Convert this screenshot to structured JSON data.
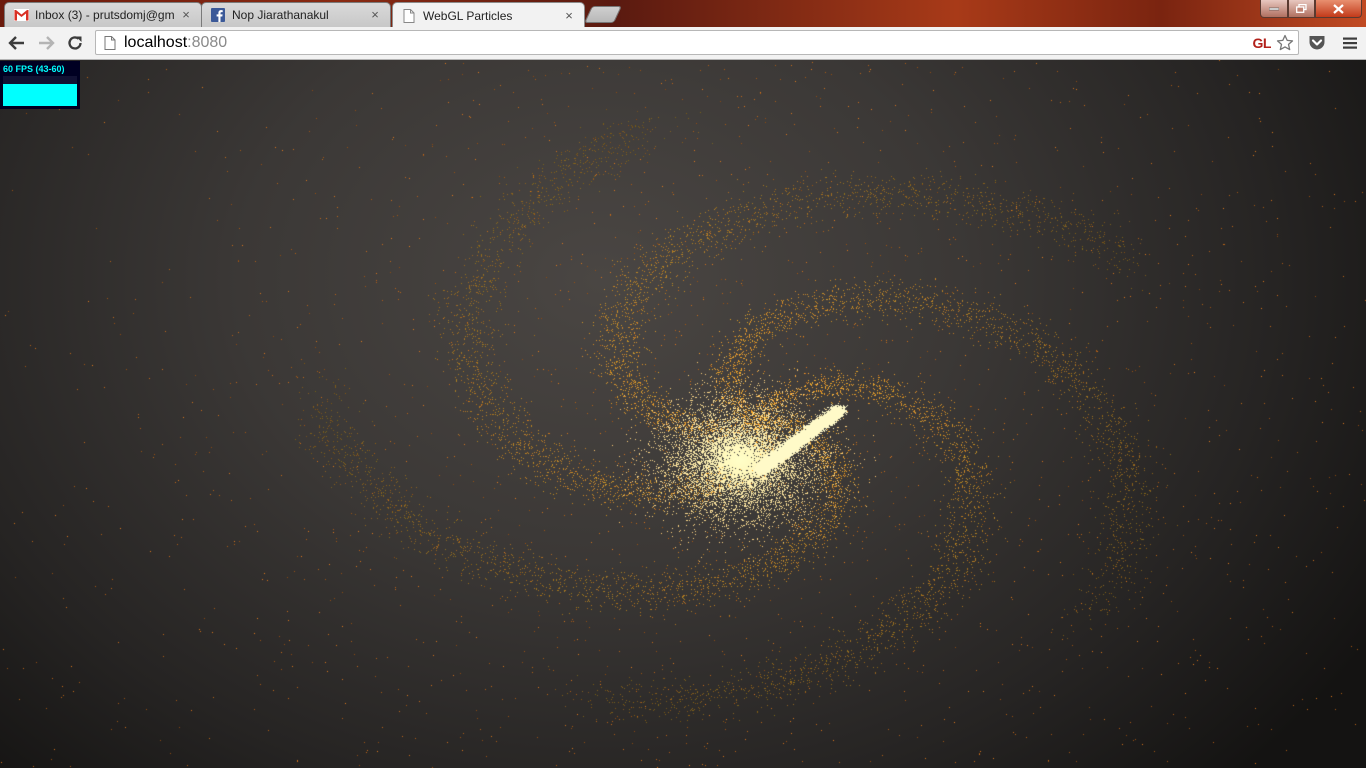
{
  "browser": {
    "tabs": [
      {
        "label": "Inbox (3) - prutsdomj@gm",
        "favicon": "gmail-icon",
        "active": false
      },
      {
        "label": "Nop Jiarathanakul",
        "favicon": "facebook-icon",
        "active": false
      },
      {
        "label": "WebGL Particles",
        "favicon": "page-icon",
        "active": true
      }
    ],
    "close_glyph": "×"
  },
  "toolbar": {
    "url_host": "localhost",
    "url_port": ":8080",
    "extension_label": "GL"
  },
  "stats": {
    "fps_text": "60 FPS (43-60)",
    "fps_level": 0.75
  },
  "colors": {
    "particle": "#f0a030",
    "particle_bright": "#fff2a0",
    "stats_fg": "#00ffff",
    "stats_bg": "#000022",
    "extension_red": "#b2201a"
  }
}
